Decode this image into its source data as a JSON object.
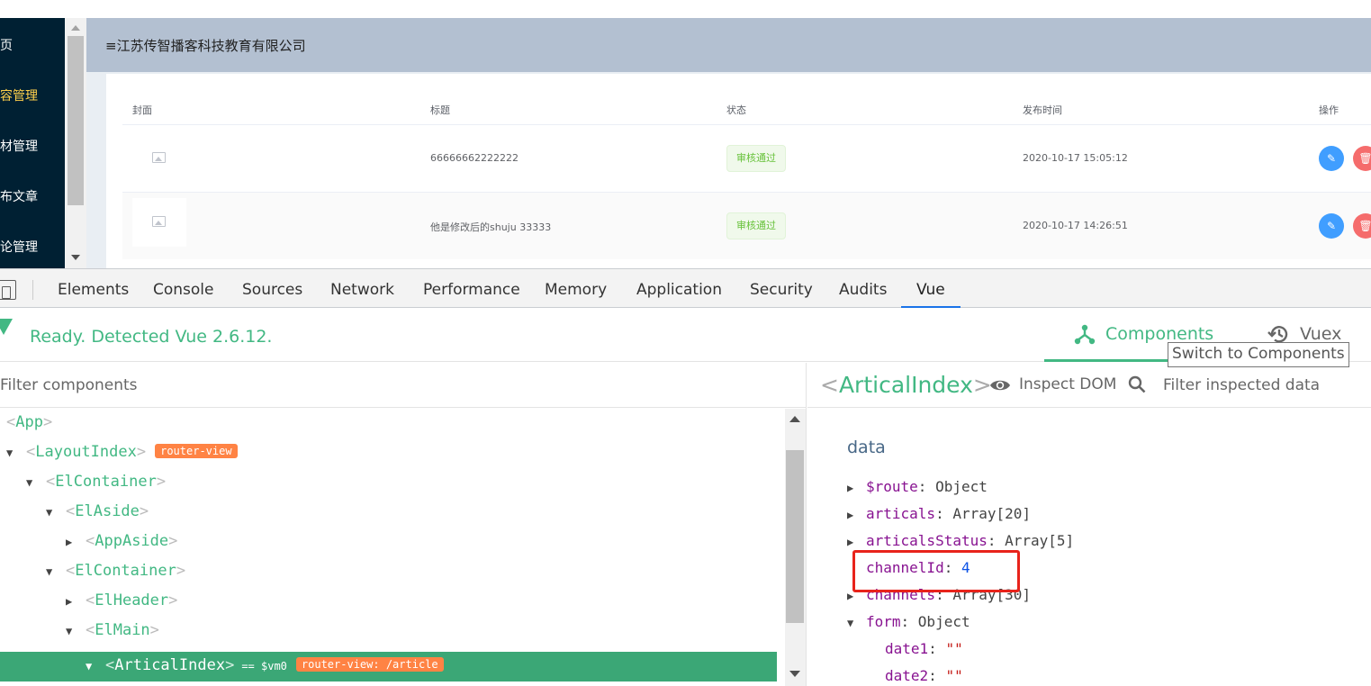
{
  "sidebar": {
    "items": [
      {
        "label": "首页",
        "active": false
      },
      {
        "label": "内容管理",
        "active": true
      },
      {
        "label": "素材管理",
        "active": false
      },
      {
        "label": "发布文章",
        "active": false
      },
      {
        "label": "评论管理",
        "active": false
      }
    ]
  },
  "header": {
    "title": "≡江苏传智播客科技教育有限公司"
  },
  "table": {
    "columns": [
      "封面",
      "标题",
      "状态",
      "发布时间",
      "操作"
    ],
    "rows": [
      {
        "title": "66666662222222",
        "status": "审核通过",
        "time": "2020-10-17 15:05:12"
      },
      {
        "title": "他是修改后的shuju 33333",
        "status": "审核通过",
        "time": "2020-10-17 14:26:51"
      }
    ]
  },
  "devtools": {
    "tabs": [
      "Elements",
      "Console",
      "Sources",
      "Network",
      "Performance",
      "Memory",
      "Application",
      "Security",
      "Audits",
      "Vue"
    ],
    "active_tab": "Vue"
  },
  "vue": {
    "status": "Ready. Detected Vue 2.6.12.",
    "nav": {
      "components": "Components",
      "vuex": "Vuex"
    },
    "tooltip": "Switch to Components",
    "filter_placeholder": "Filter components",
    "tree": [
      {
        "name": "App",
        "arrow": "",
        "badge": ""
      },
      {
        "name": "LayoutIndex",
        "arrow": "▼",
        "badge": "router-view"
      },
      {
        "name": "ElContainer",
        "arrow": "▼",
        "badge": ""
      },
      {
        "name": "ElAside",
        "arrow": "▼",
        "badge": ""
      },
      {
        "name": "AppAside",
        "arrow": "▶",
        "badge": ""
      },
      {
        "name": "ElContainer",
        "arrow": "▼",
        "badge": ""
      },
      {
        "name": "ElHeader",
        "arrow": "▶",
        "badge": ""
      },
      {
        "name": "ElMain",
        "arrow": "▼",
        "badge": ""
      },
      {
        "name": "ArticalIndex",
        "arrow": "▼",
        "badge": "router-view: /article",
        "vm": "== $vm0",
        "selected": true
      }
    ],
    "inspector": {
      "component": "ArticalIndex",
      "inspect_dom": "Inspect DOM",
      "filter_placeholder": "Filter inspected data",
      "section": "data",
      "props": [
        {
          "arrow": "▶",
          "key": "$route",
          "value": "Object"
        },
        {
          "arrow": "▶",
          "key": "articals",
          "value": "Array[20]"
        },
        {
          "arrow": "▶",
          "key": "articalsStatus",
          "value": "Array[5]"
        },
        {
          "arrow": "",
          "key": "channelId",
          "value": "4"
        },
        {
          "arrow": "▶",
          "key": "channels",
          "value": "Array[30]"
        },
        {
          "arrow": "▼",
          "key": "form",
          "value": "Object"
        },
        {
          "arrow": "",
          "key": "date1",
          "value": "\"\""
        },
        {
          "arrow": "",
          "key": "date2",
          "value": "\"\""
        }
      ]
    }
  },
  "colors": {
    "vue_green": "#42b883",
    "sidebar_bg": "#002033",
    "sidebar_active": "#ffd04b",
    "header_bg": "#b3c0d1",
    "router_badge": "#ff8344",
    "highlight": "#e8231b"
  },
  "icons": [
    "image-placeholder-icon",
    "edit-icon",
    "delete-icon",
    "device-toggle-icon",
    "vue-logo-icon",
    "components-icon",
    "history-icon",
    "eye-icon",
    "search-icon"
  ]
}
